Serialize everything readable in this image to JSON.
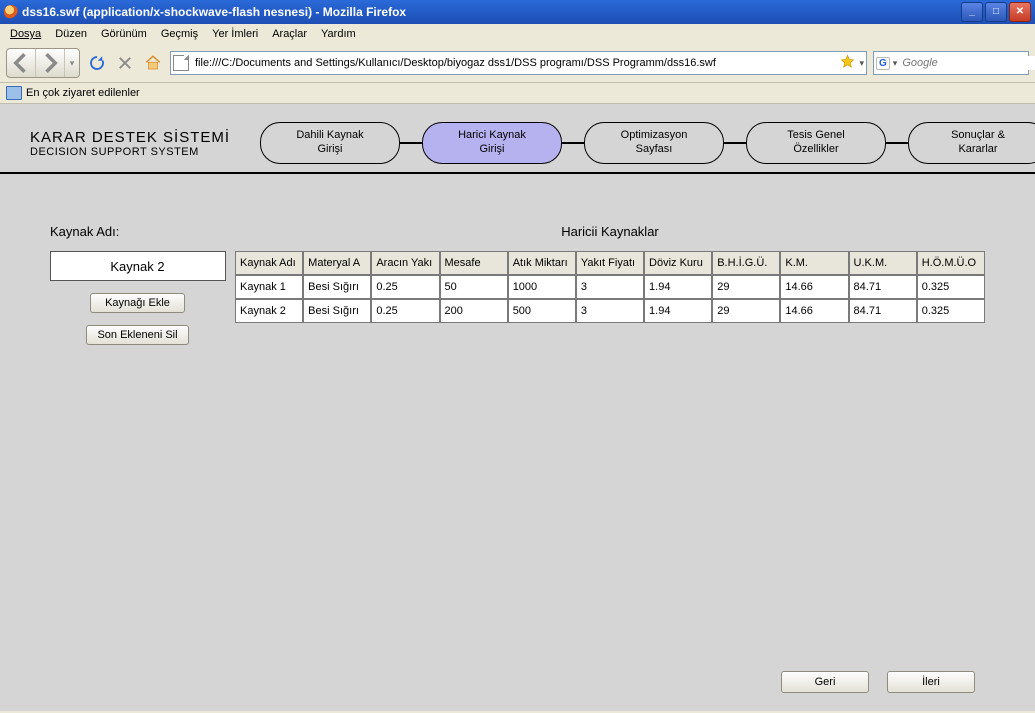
{
  "window": {
    "title": "dss16.swf (application/x-shockwave-flash nesnesi) - Mozilla Firefox"
  },
  "menubar": {
    "file": "Dosya",
    "edit": "Düzen",
    "view": "Görünüm",
    "history": "Geçmiş",
    "bookmarks": "Yer İmleri",
    "tools": "Araçlar",
    "help": "Yardım"
  },
  "addressbar": {
    "url": "file:///C:/Documents and Settings/Kullanıcı/Desktop/biyogaz dss1/DSS programı/DSS Programm/dss16.swf"
  },
  "searchbox": {
    "placeholder": "Google"
  },
  "bookmarksbar": {
    "mostvisited": "En çok ziyaret edilenler"
  },
  "app": {
    "title1": "KARAR DESTEK SİSTEMİ",
    "title2": "DECISION SUPPORT SYSTEM",
    "steps": [
      "Dahili Kaynak Girişi",
      "Harici Kaynak Girişi",
      "Optimizasyon Sayfası",
      "Tesis Genel Özellikler",
      "Sonuçlar & Kararlar"
    ],
    "step_active_index": 1
  },
  "form": {
    "label": "Kaynak Adı:",
    "value": "Kaynak 2",
    "btn_add": "Kaynağı Ekle",
    "btn_del": "Son Ekleneni Sil"
  },
  "table": {
    "title": "Haricii Kaynaklar",
    "headers": [
      "Kaynak Adı",
      "Materyal A",
      "Aracın Yakı",
      "Mesafe",
      "Atık Miktarı",
      "Yakıt Fiyatı",
      "Döviz Kuru",
      "B.H.İ.G.Ü.",
      "K.M.",
      "U.K.M.",
      "H.Ö.M.Ü.O"
    ],
    "rows": [
      [
        "Kaynak 1",
        "Besi Sığırı",
        "0.25",
        "50",
        "1000",
        "3",
        "1.94",
        "29",
        "14.66",
        "84.71",
        "0.325"
      ],
      [
        "Kaynak 2",
        "Besi Sığırı",
        "0.25",
        "200",
        "500",
        "3",
        "1.94",
        "29",
        "14.66",
        "84.71",
        "0.325"
      ]
    ]
  },
  "footer": {
    "back": "Geri",
    "next": "İleri"
  }
}
